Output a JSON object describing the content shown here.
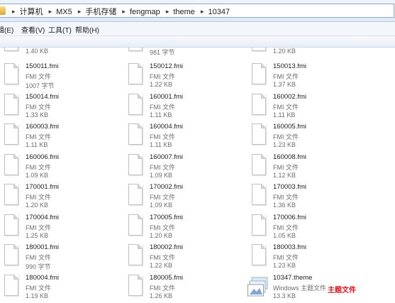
{
  "address": {
    "segments": [
      "计算机",
      "MX5",
      "手机存储",
      "fengmap",
      "theme",
      "10347"
    ]
  },
  "menu": [
    "编辑(E)",
    "查看(V)",
    "工具(T)",
    "帮助(H)"
  ],
  "partial_row": [
    {
      "size": "1.40 KB"
    },
    {
      "size": "981 字节"
    },
    {
      "size": "1.20 KB"
    }
  ],
  "files": [
    {
      "name": "150011.fmi",
      "type": "FMI 文件",
      "size": "1007 字节"
    },
    {
      "name": "150012.fmi",
      "type": "FMI 文件",
      "size": "1.22 KB"
    },
    {
      "name": "150013.fmi",
      "type": "FMI 文件",
      "size": "1.37 KB"
    },
    {
      "name": "150014.fmi",
      "type": "FMI 文件",
      "size": "1.33 KB"
    },
    {
      "name": "160001.fmi",
      "type": "FMI 文件",
      "size": "1.11 KB"
    },
    {
      "name": "160002.fmi",
      "type": "FMI 文件",
      "size": "1.11 KB"
    },
    {
      "name": "160003.fmi",
      "type": "FMI 文件",
      "size": "1.11 KB"
    },
    {
      "name": "160004.fmi",
      "type": "FMI 文件",
      "size": "1.11 KB"
    },
    {
      "name": "160005.fmi",
      "type": "FMI 文件",
      "size": "1.23 KB"
    },
    {
      "name": "160006.fmi",
      "type": "FMI 文件",
      "size": "1.09 KB"
    },
    {
      "name": "160007.fmi",
      "type": "FMI 文件",
      "size": "1.09 KB"
    },
    {
      "name": "160008.fmi",
      "type": "FMI 文件",
      "size": "1.12 KB"
    },
    {
      "name": "170001.fmi",
      "type": "FMI 文件",
      "size": "1.20 KB"
    },
    {
      "name": "170002.fmi",
      "type": "FMI 文件",
      "size": "1.09 KB"
    },
    {
      "name": "170003.fmi",
      "type": "FMI 文件",
      "size": "1.36 KB"
    },
    {
      "name": "170004.fmi",
      "type": "FMI 文件",
      "size": "1.25 KB"
    },
    {
      "name": "170005.fmi",
      "type": "FMI 文件",
      "size": "1.20 KB"
    },
    {
      "name": "170006.fmi",
      "type": "FMI 文件",
      "size": "1.05 KB"
    },
    {
      "name": "180001.fmi",
      "type": "FMI 文件",
      "size": "990 字节"
    },
    {
      "name": "180002.fmi",
      "type": "FMI 文件",
      "size": "1.22 KB"
    },
    {
      "name": "180003.fmi",
      "type": "FMI 文件",
      "size": "1.23 KB"
    },
    {
      "name": "180004.fmi",
      "type": "FMI 文件",
      "size": "1.19 KB"
    },
    {
      "name": "180005.fmi",
      "type": "FMI 文件",
      "size": "1.26 KB"
    },
    {
      "name": "10347.theme",
      "type": "Windows 主题文件",
      "size": "13.3 KB",
      "icon": "windows-theme-icon"
    }
  ],
  "annotation": "主题文件",
  "colors": {
    "annotation": "#e0141e",
    "secondary_text": "#6d6d6d"
  }
}
